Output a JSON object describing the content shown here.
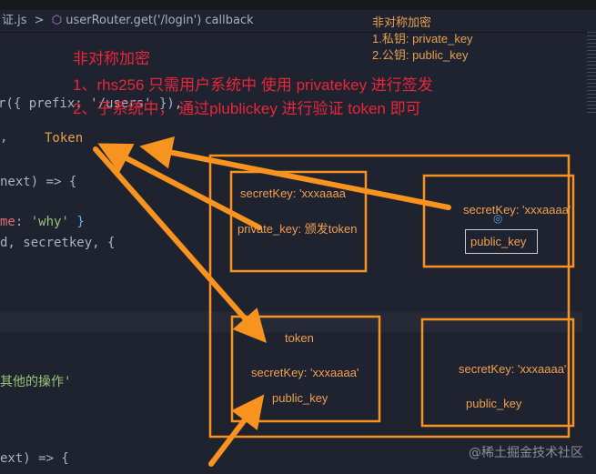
{
  "breadcrumb": {
    "file": "证.js",
    "separator": ">",
    "symbol": "userRouter.get('/login') callback"
  },
  "code_lines": {
    "l1": "r({ prefix: '/users' }),",
    "l2_comma": ",",
    "l3": "next) => {",
    "l4_key": "me",
    "l4_val": "'why'",
    "l5": "d, secretkey, {",
    "l6": "其他的操作'",
    "l7": "ext) => {"
  },
  "token_label": "Token",
  "red_notes": {
    "title": "非对称加密",
    "line1": "1、rhs256  只需用户系统中 使用 privatekey 进行签发",
    "line2": "2、子系统中， 通过plublickey 进行验证 token 即可"
  },
  "top_note": {
    "title": "非对称加密",
    "line1": "1.私钥: private_key",
    "line2": "2.公钥: public_key"
  },
  "boxes": {
    "a": {
      "secret": "secretKey: 'xxxaaaa",
      "private": "private_key: 颁发token"
    },
    "b": {
      "secret": "secretKey: 'xxxaaaa'",
      "public_input": "public_key"
    },
    "c": {
      "token": "token",
      "secret": "secretKey: 'xxxaaaa'",
      "public": "public_key"
    },
    "d": {
      "secret": "secretKey: 'xxxaaaa'",
      "public": "public_key"
    }
  },
  "watermark": "@稀土掘金技术社区",
  "colors": {
    "annotation": "#f7931e",
    "red_text": "#e8263a"
  }
}
